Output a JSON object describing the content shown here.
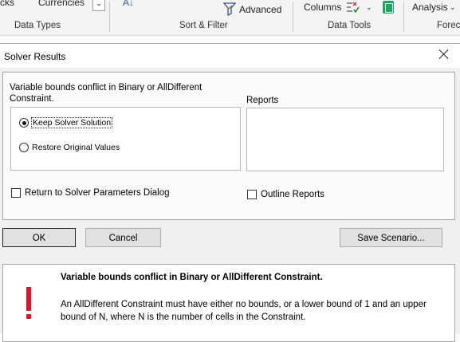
{
  "ribbon": {
    "cut_left_text": "cks",
    "currencies": "Currencies",
    "data_types_group": "Data Types",
    "advanced": "Advanced",
    "sort_filter_group": "Sort & Filter",
    "columns": "Columns",
    "data_tools_group": "Data Tools",
    "analysis": "Analysis",
    "forecast_group_cut": "Forec"
  },
  "dialog": {
    "title": "Solver Results",
    "message": "Variable bounds conflict in Binary or AllDifferent Constraint.",
    "reports_label": "Reports",
    "options": [
      {
        "label": "Keep Solver Solution",
        "checked": true
      },
      {
        "label": "Restore Original Values",
        "checked": false
      }
    ],
    "return_label": "Return to Solver Parameters Dialog",
    "outline_label": "Outline Reports",
    "buttons": {
      "ok": "OK",
      "cancel": "Cancel",
      "save_scenario": "Save Scenario..."
    },
    "info": {
      "title": "Variable bounds conflict in Binary or AllDifferent Constraint.",
      "body": "An AllDifferent Constraint must have either no bounds, or a lower bound of 1 and an upper bound of N, where N is the number of cells in the Constraint."
    }
  },
  "colors": {
    "error_red": "#e81123",
    "dialog_bg": "#f0f0f0",
    "button_bg": "#e1e1e1"
  }
}
